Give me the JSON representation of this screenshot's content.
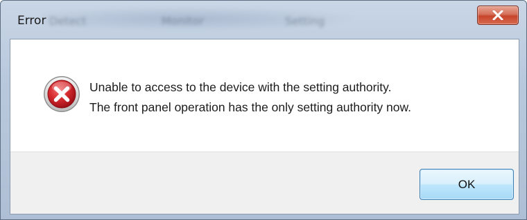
{
  "window": {
    "title": "Error",
    "background_labels": [
      "Detect",
      "Monitor",
      "Setting"
    ]
  },
  "titlebar": {
    "close_icon": "close-icon"
  },
  "dialog": {
    "icon": "error-icon",
    "message_line1": "Unable to access to the device with the setting authority.",
    "message_line2": "The front panel operation has the only setting authority now.",
    "ok_label": "OK"
  },
  "colors": {
    "close_button": "#c7452b",
    "error_icon": "#c8202b",
    "ok_button_border": "#3c7fb1"
  }
}
